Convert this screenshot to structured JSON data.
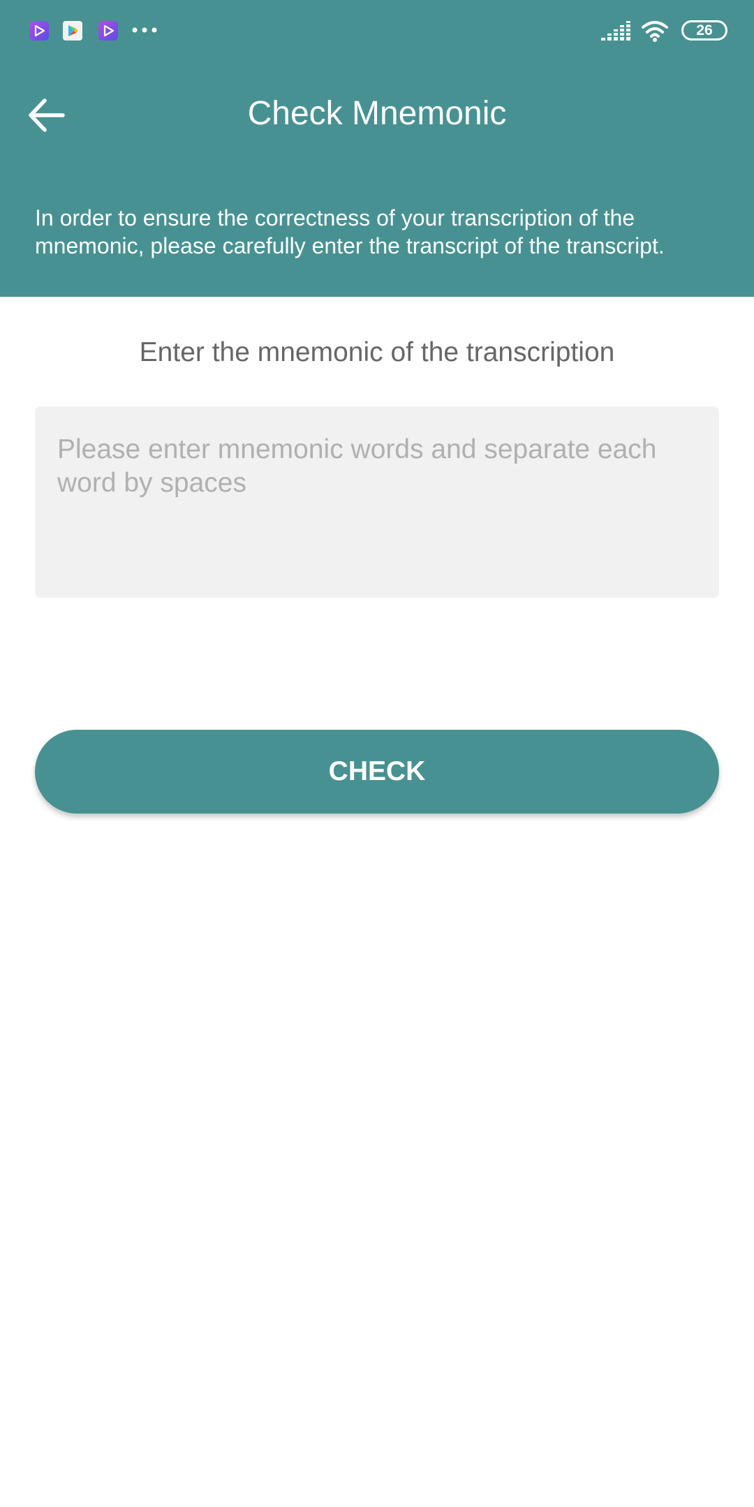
{
  "status_bar": {
    "notification_icons": [
      "video-player-icon",
      "play-store-icon",
      "video-player-icon"
    ],
    "more_icon": "more-dots-icon",
    "signal_icon": "signal-icon",
    "wifi_icon": "wifi-icon",
    "battery_level": "26"
  },
  "header": {
    "back_icon": "back-arrow-icon",
    "title": "Check Mnemonic",
    "instructions": "In order to ensure the correctness of your transcription of the mnemonic, please carefully enter the transcript of the transcript."
  },
  "main": {
    "section_label": "Enter the mnemonic of the transcription",
    "input": {
      "value": "",
      "placeholder": "Please enter mnemonic words and separate each word by spaces"
    },
    "check_button_label": "CHECK"
  },
  "colors": {
    "primary": "#489192",
    "input_background": "#f1f1f1",
    "placeholder_text": "#b0b0b0",
    "label_text": "#666666"
  }
}
